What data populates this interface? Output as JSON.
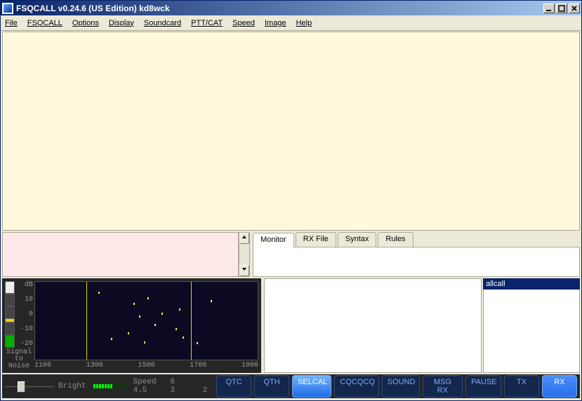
{
  "window": {
    "title": "FSQCALL v0.24.6 (US Edition)  kd8wck"
  },
  "menu": {
    "items": [
      "File",
      "FSQCALL",
      "Options",
      "Display",
      "Soundcard",
      "PTT/CAT",
      "Speed",
      "Image",
      "Help"
    ]
  },
  "tabs": {
    "items": [
      "Monitor",
      "RX File",
      "Syntax",
      "Rules"
    ],
    "active_index": 0
  },
  "heard": {
    "header": "allcall"
  },
  "sn": {
    "title_line1": "Signal",
    "title_line2": "to Noise",
    "labels": [
      "dB",
      "10",
      "0",
      "-10",
      "-20"
    ]
  },
  "freq_scale": [
    "1100",
    "1300",
    "1500",
    "1700",
    "1900"
  ],
  "bottom": {
    "bright_label": "Bright",
    "speed_label": "Speed",
    "speed_ticks": [
      "6",
      "4.5",
      "3",
      "2"
    ]
  },
  "buttons": {
    "qtc": "QTC",
    "qth": "QTH",
    "selcal": "SELCAL",
    "cqcqcq": "CQCQCQ",
    "sound": "SOUND",
    "msgrx": "MSG RX",
    "pause": "PAUSE",
    "tx": "TX",
    "rx": "RX"
  },
  "waterfall_markers": [
    135,
    283
  ]
}
